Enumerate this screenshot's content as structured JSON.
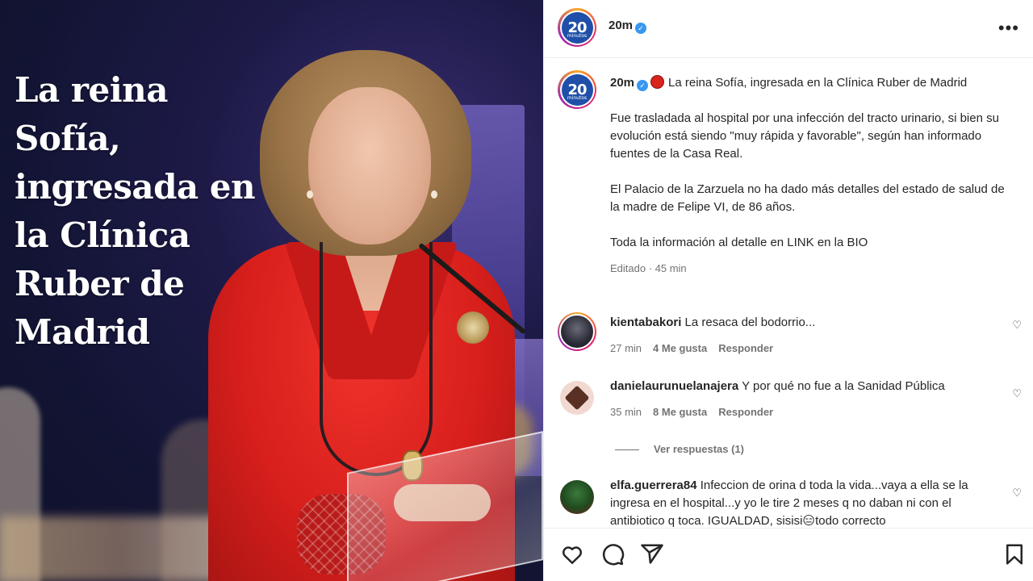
{
  "post_image": {
    "headline": "La reina Sofía, ingresada en la Clínica Ruber de Madrid"
  },
  "header": {
    "username": "20m",
    "verified": true,
    "avatar_text": "20",
    "avatar_subtext": "minutos",
    "more_icon": "more-horizontal-icon"
  },
  "caption": {
    "username": "20m",
    "title": "La reina Sofía, ingresada en la Clínica Ruber de Madrid",
    "paragraph1": "Fue trasladada al hospital por una infección del tracto urinario, si bien su evolución está siendo \"muy rápida y favorable\", según han informado fuentes de la Casa Real.",
    "paragraph2": "El Palacio de la Zarzuela no ha dado más detalles del estado de salud de la madre de Felipe VI, de 86 años.",
    "paragraph3": "Toda la información al detalle en LINK en la BIO",
    "meta": "Editado · 45 min"
  },
  "comments": [
    {
      "username": "kientabakori",
      "text": "La resaca del bodorrio...",
      "time": "27 min",
      "likes": "4 Me gusta",
      "reply": "Responder"
    },
    {
      "username": "danielaurunuelanajera",
      "text": "Y por qué no fue a la Sanidad Pública",
      "time": "35 min",
      "likes": "8 Me gusta",
      "reply": "Responder"
    },
    {
      "username": "elfa.guerrera84",
      "text": "Infeccion de orina d toda la vida...vaya a ella se la ingresa en el hospital...y yo le tire 2 meses q no daban ni con el antibiotico q toca. IGUALDAD, sisisi😑todo correcto"
    }
  ],
  "view_replies": "Ver respuestas (1)",
  "actions": {
    "like_icon": "heart-icon",
    "comment_icon": "comment-icon",
    "share_icon": "send-icon",
    "save_icon": "bookmark-icon"
  }
}
